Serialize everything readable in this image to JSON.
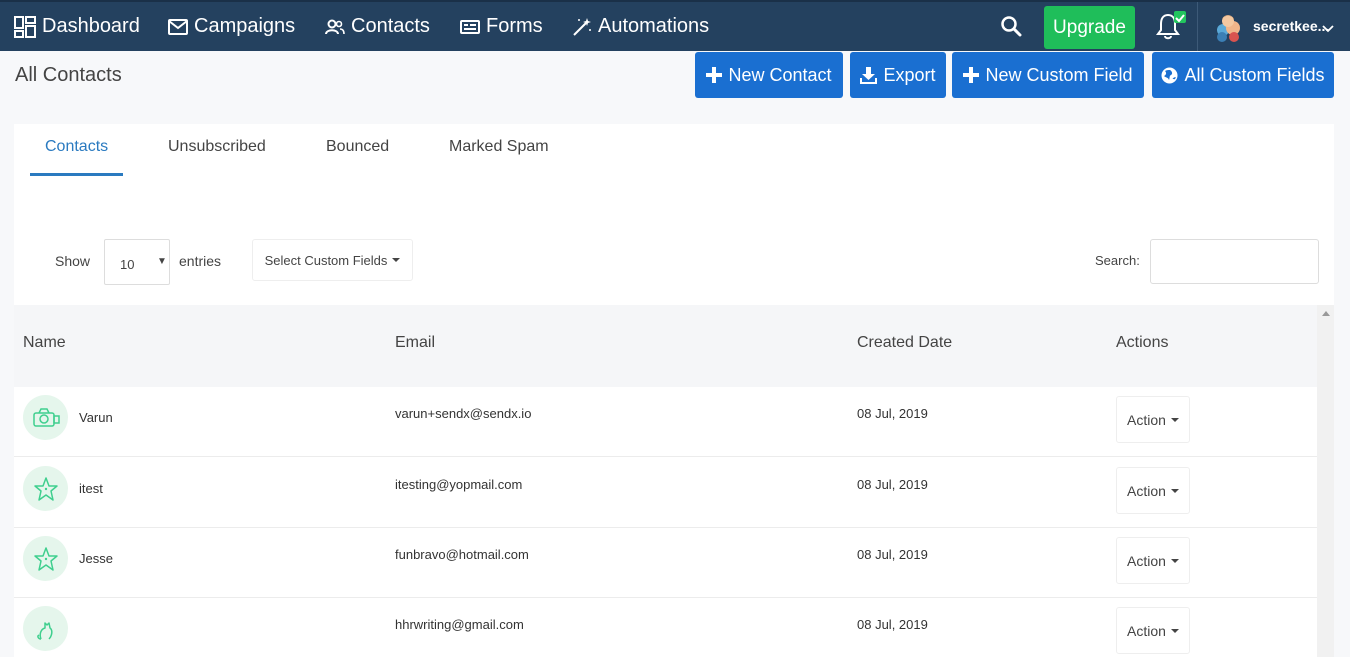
{
  "nav": {
    "dashboard": "Dashboard",
    "campaigns": "Campaigns",
    "contacts": "Contacts",
    "forms": "Forms",
    "automations": "Automations",
    "upgrade": "Upgrade",
    "username": "secretkee..."
  },
  "page": {
    "title": "All Contacts",
    "new_contact": "New Contact",
    "export": "Export",
    "new_custom_field": "New Custom Field",
    "all_custom_fields": "All Custom Fields"
  },
  "tabs": [
    "Contacts",
    "Unsubscribed",
    "Bounced",
    "Marked Spam"
  ],
  "controls": {
    "show": "Show",
    "entries_value": "10",
    "entries": "entries",
    "custom_fields": "Select Custom Fields",
    "search": "Search:"
  },
  "table": {
    "headers": [
      "Name",
      "Email",
      "Created Date",
      "Actions"
    ],
    "rows": [
      {
        "name": "Varun",
        "email": "varun+sendx@sendx.io",
        "date": "08 Jul, 2019",
        "action": "Action",
        "avatar_icon": "camera-icon"
      },
      {
        "name": "itest",
        "email": "itesting@yopmail.com",
        "date": "08 Jul, 2019",
        "action": "Action",
        "avatar_icon": "starfish-icon"
      },
      {
        "name": "Jesse",
        "email": "funbravo@hotmail.com",
        "date": "08 Jul, 2019",
        "action": "Action",
        "avatar_icon": "starfish-icon"
      },
      {
        "name": "",
        "email": "hhrwriting@gmail.com",
        "date": "08 Jul, 2019",
        "action": "Action",
        "avatar_icon": "cat-icon"
      }
    ]
  },
  "colors": {
    "nav_bg": "#24415f",
    "primary": "#1a6fd1",
    "upgrade": "#1fbe5a",
    "tab_active": "#2a7ac0",
    "avatar_bg": "#e5f6ec"
  }
}
